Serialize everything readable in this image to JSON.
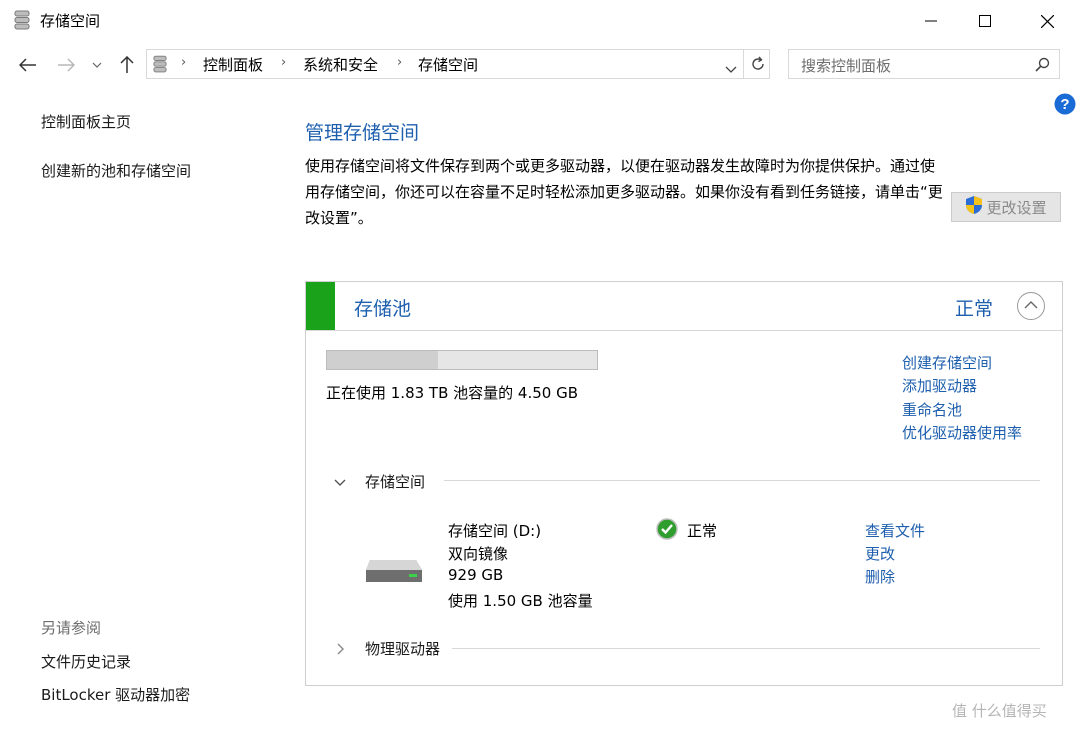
{
  "window": {
    "title": "存储空间"
  },
  "address_bar": {
    "crumbs": [
      "控制面板",
      "系统和安全",
      "存储空间"
    ],
    "search_placeholder": "搜索控制面板"
  },
  "left_pane": {
    "links": [
      "控制面板主页",
      "创建新的池和存储空间"
    ],
    "see_also_label": "另请参阅",
    "see_also_links": [
      "文件历史记录",
      "BitLocker 驱动器加密"
    ]
  },
  "main": {
    "heading": "管理存储空间",
    "description": "使用存储空间将文件保存到两个或更多驱动器，以便在驱动器发生故障时为你提供保护。通过使用存储空间，你还可以在容量不足时轻松添加更多驱动器。如果你没有看到任务链接，请单击“更改设置”。",
    "change_settings_label": "更改设置"
  },
  "pool": {
    "title": "存储池",
    "status": "正常",
    "usage_fraction": 0.41,
    "usage_text": "正在使用 1.83 TB 池容量的 4.50 GB",
    "actions": [
      "创建存储空间",
      "添加驱动器",
      "重命名池",
      "优化驱动器使用率"
    ]
  },
  "spaces_section": {
    "label": "存储空间",
    "drive": {
      "name": "存储空间 (D:)",
      "type": "双向镜像",
      "size": "929 GB",
      "usage": "使用 1.50 GB 池容量",
      "status": "正常",
      "actions": [
        "查看文件",
        "更改",
        "删除"
      ]
    }
  },
  "physical_section": {
    "label": "物理驱动器"
  },
  "watermark": "值 什么值得买",
  "colors": {
    "link": "#1e5fae",
    "status_green": "#1aa31a"
  }
}
